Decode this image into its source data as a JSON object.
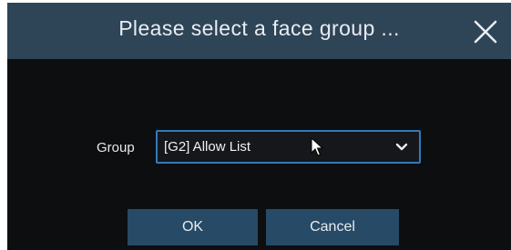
{
  "dialog": {
    "title": "Please select a face group ...",
    "close_icon": "close-icon"
  },
  "form": {
    "group_label": "Group",
    "group_select": {
      "value": "[G2] Allow List",
      "icon": "chevron-down-icon"
    }
  },
  "actions": {
    "ok_label": "OK",
    "cancel_label": "Cancel"
  },
  "colors": {
    "title_bar": "#2e4457",
    "background": "#0d0e10",
    "button": "#274a66",
    "select_border": "#2f7bbd"
  }
}
